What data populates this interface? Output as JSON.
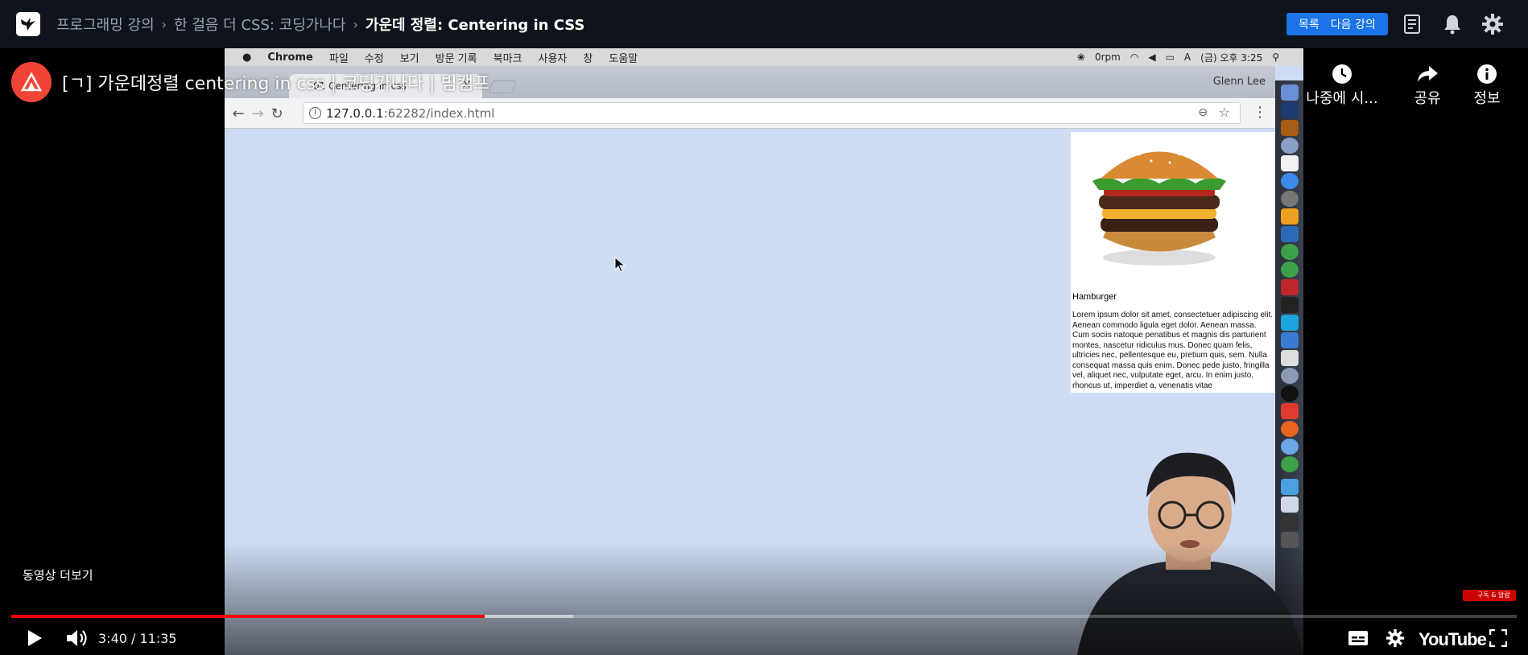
{
  "breadcrumb": {
    "items": [
      "프로그래밍 강의",
      "한 걸음 더 CSS: 코딩가나다",
      "가운데 정렬: Centering in CSS"
    ]
  },
  "topbar": {
    "list_label": "목록",
    "next_label": "다음 강의"
  },
  "video": {
    "title": "[ㄱ] 가운데정렬 centering in css | 코딩가나다 | 빔캠프",
    "actions": {
      "watch_later": "나중에 시...",
      "share": "공유",
      "info": "정보"
    },
    "more_videos": "동영상 더보기",
    "time_current": "3:40",
    "time_total": "11:35",
    "time_sep": " / ",
    "progress": 0.3147,
    "buffered": 0.3734,
    "youtube_logo": "YouTube",
    "subscribe_badge": "구독 & 알람"
  },
  "mac": {
    "menu": [
      "Chrome",
      "파일",
      "수정",
      "보기",
      "방문 기록",
      "북마크",
      "사용자",
      "창",
      "도움말"
    ],
    "status": {
      "rpm": "0rpm",
      "clock": "(금) 오후 3:25",
      "input": "A"
    }
  },
  "browser": {
    "tab_title": "01 Centering in css",
    "profile": "Glenn Lee",
    "url_host": "127.0.0.1",
    "url_rest": ":62282/index.html"
  },
  "page": {
    "card_title": "Hamburger",
    "card_text": "Lorem ipsum dolor sit amet, consectetuer adipiscing elit. Aenean commodo ligula eget dolor. Aenean massa. Cum sociis natoque penatibus et magnis dis parturient montes, nascetur ridiculus mus. Donec quam felis, ultricies nec, pellentesque eu, pretium quis, sem. Nulla consequat massa quis enim. Donec pede justo, fringilla vel, aliquet nec, vulputate eget, arcu. In enim justo, rhoncus ut, imperdiet a, venenatis vitae"
  },
  "colors": {
    "accent": "#1a73e8",
    "progress": "#ff0000",
    "page_bg": "#cddcf3",
    "topbar": "#0f141c"
  }
}
